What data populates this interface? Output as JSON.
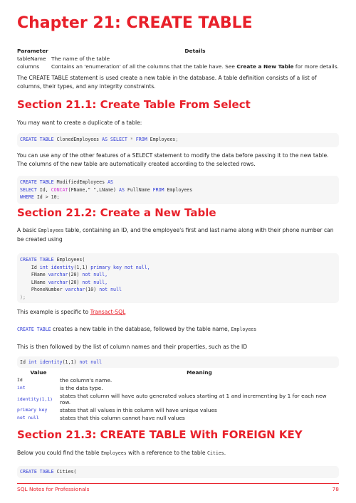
{
  "chapter_title": "Chapter 21: CREATE TABLE",
  "params_table": {
    "headers": [
      "Parameter",
      "Details"
    ],
    "rows": [
      {
        "param": "tableName",
        "details": "The name of the table"
      },
      {
        "param": "columns",
        "details_pre": "Contains an 'enumeration' of all the columns that the table have. See ",
        "details_bold": "Create a New Table",
        "details_post": " for more details."
      }
    ]
  },
  "intro": "The CREATE TABLE statement is used create a new table in the database. A table definition consists of a list of columns, their types, and any integrity constraints.",
  "section1": {
    "title": "Section 21.1: Create Table From Select",
    "p1": "You may want to create a duplicate of a table:",
    "code1": {
      "kw1": "CREATE TABLE",
      "t1": " ClonedEmployees ",
      "kw2": "AS SELECT",
      "op": " * ",
      "kw3": "FROM",
      "t2": " Employees",
      "end": ";"
    },
    "p2": "You can use any of the other features of a SELECT statement to modify the data before passing it to the new table. The columns of the new table are automatically created according to the selected rows.",
    "code2": {
      "l1_kw": "CREATE TABLE",
      "l1_t": " ModifiedEmployees ",
      "l1_kw2": "AS",
      "l2_kw": "SELECT",
      "l2_t": " Id, ",
      "l2_fn": "CONCAT",
      "l2_t2": "(FName,\" \",LName) ",
      "l2_kw2": "AS",
      "l2_t3": " FullName ",
      "l2_kw3": "FROM",
      "l2_t4": " Employees",
      "l3_kw": "WHERE",
      "l3_t": " Id > 10;"
    }
  },
  "section2": {
    "title": "Section 21.2: Create a New Table",
    "p1_pre": "A basic ",
    "p1_code": "Employees",
    "p1_post": " table, containing an ID, and the employee's first and last name along with their phone number can be created using",
    "code": {
      "l1_kw": "CREATE TABLE",
      "l1_t": " Employees(",
      "l2_t": "    Id ",
      "l2_kw": "int identity",
      "l2_t2": "(1,1) ",
      "l2_kw2": "primary key",
      "l2_op": " not null,",
      "l3_t": "    FName ",
      "l3_kw": "varchar",
      "l3_t2": "(20) ",
      "l3_op": "not null,",
      "l4_t": "    LName ",
      "l4_kw": "varchar",
      "l4_t2": "(20) ",
      "l4_op": "not null,",
      "l5_t": "    PhoneNumber ",
      "l5_kw": "varchar",
      "l5_t2": "(10) ",
      "l5_op": "not null",
      "l6": ");"
    },
    "p2_pre": "This example is specific to ",
    "p2_link": "Transact-SQL",
    "p3_code": "CREATE TABLE",
    "p3_mid": " creates a new table in the database, followed by the table name, ",
    "p3_code2": "Employees",
    "p4": "This is then followed by the list of column names and their properties, such as the ID",
    "code2": {
      "t1": "Id ",
      "kw1": "int identity",
      "t2": "(1,1) ",
      "op": "not null"
    },
    "vm_table": {
      "headers": [
        "Value",
        "Meaning"
      ],
      "rows": [
        {
          "value": "Id",
          "meaning": "the column's name."
        },
        {
          "value": "int",
          "meaning": "is the data type."
        },
        {
          "value": "identity(1,1)",
          "meaning": "states that column will have auto generated values starting at 1 and incrementing by 1 for each new row."
        },
        {
          "value": "primary key",
          "meaning": "states that all values in this column will have unique values"
        },
        {
          "value": "not null",
          "meaning": "states that this column cannot have null values"
        }
      ]
    }
  },
  "section3": {
    "title": "Section 21.3: CREATE TABLE With FOREIGN KEY",
    "p1_pre": "Below you could find the table ",
    "p1_code": "Employees",
    "p1_mid": " with a reference to the table ",
    "p1_code2": "Cities",
    "p1_post": ".",
    "code": {
      "kw": "CREATE TABLE",
      "t": " Cities("
    }
  },
  "footer": {
    "book": "SQL Notes for Professionals",
    "page": "78"
  },
  "colors": {
    "accent": "#e8202a",
    "keyword": "#2f3bd6",
    "function": "#d63ad6",
    "code_bg": "#f6f6f6"
  }
}
